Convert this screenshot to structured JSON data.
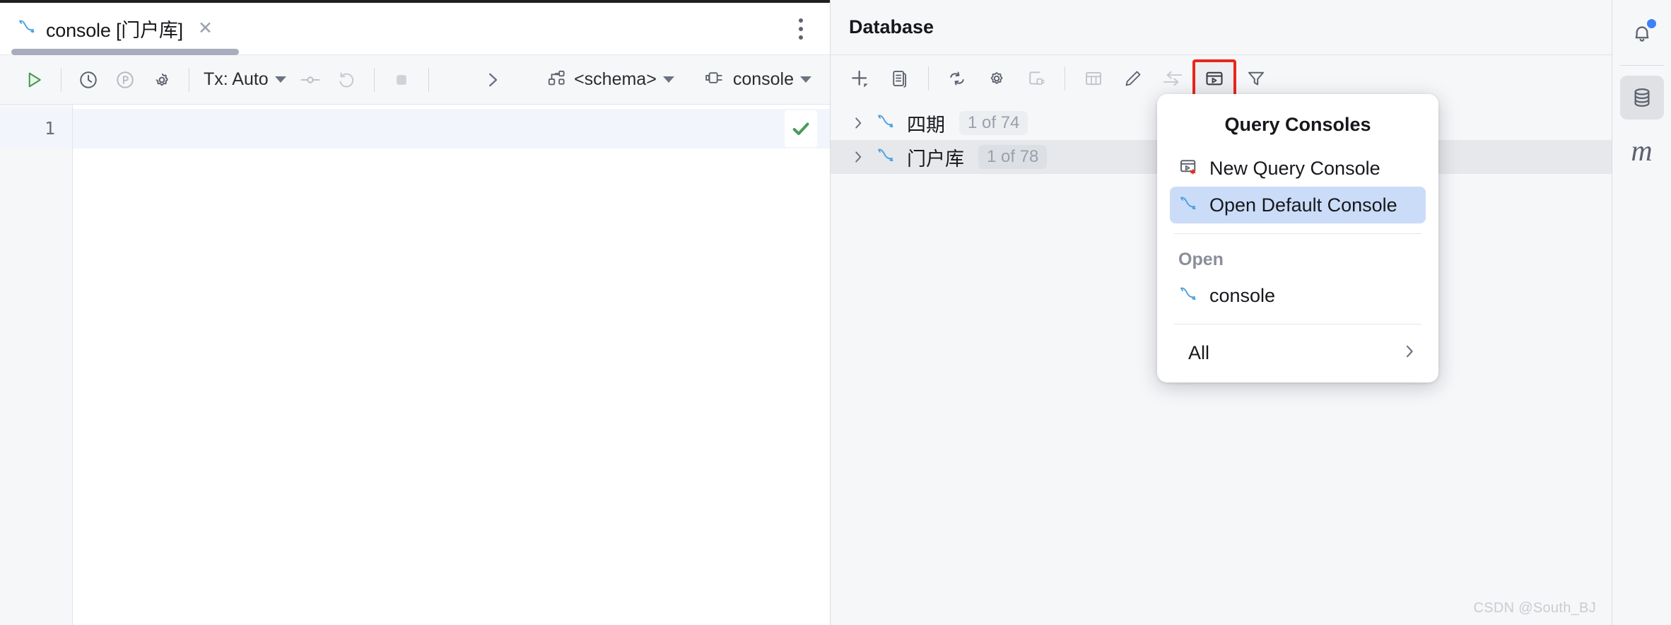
{
  "window": {
    "watermark": "CSDN @South_BJ"
  },
  "editor": {
    "tab": {
      "icon": "mysql-dolphin-icon",
      "label": "console [门户库]",
      "close_label": "✕"
    },
    "kebab_label": "more-options",
    "toolbar": {
      "execute_label": "execute-icon",
      "history_label": "history-icon",
      "profile_label": "profile-icon",
      "settings_label": "gear-icon",
      "tx_label": "Tx: Auto",
      "commit_label": "commit-icon",
      "rollback_label": "rollback-icon",
      "stop_label": "stop-icon",
      "expand_label": "›",
      "schema_label": "<schema>",
      "session_label": "console"
    },
    "gutter": {
      "lines": [
        "1"
      ]
    },
    "code": {
      "line1": ""
    },
    "status": {
      "check_label": "✓"
    }
  },
  "database": {
    "header": {
      "title": "Database"
    },
    "toolbar": [
      {
        "name": "add-icon",
        "title": "New"
      },
      {
        "name": "duplicate-icon",
        "title": "Duplicate"
      },
      {
        "name": "refresh-icon",
        "title": "Refresh"
      },
      {
        "name": "gear-icon",
        "title": "Data Source Properties"
      },
      {
        "name": "disconnect-icon",
        "title": "Disconnect"
      },
      {
        "name": "table-icon",
        "title": "Table"
      },
      {
        "name": "edit-icon",
        "title": "Modify"
      },
      {
        "name": "jump-to-icon",
        "title": "Jump to"
      },
      {
        "name": "query-console-icon",
        "title": "Query Console",
        "highlighted": true
      },
      {
        "name": "filter-icon",
        "title": "Filter"
      }
    ],
    "tree": [
      {
        "label": "四期",
        "badge": "1 of 74",
        "icon": "mysql-dolphin-icon",
        "selected": false
      },
      {
        "label": "门户库",
        "badge": "1 of 78",
        "icon": "mysql-dolphin-icon",
        "selected": true
      }
    ]
  },
  "popup": {
    "title": "Query Consoles",
    "items": [
      {
        "label": "New Query Console",
        "icon": "new-query-console-icon",
        "active": false
      },
      {
        "label": "Open Default Console",
        "icon": "mysql-dolphin-icon",
        "active": true
      }
    ],
    "section_label": "Open",
    "open_items": [
      {
        "label": "console",
        "icon": "mysql-dolphin-icon"
      }
    ],
    "all_label": "All",
    "all_chevron": "›"
  },
  "rail": {
    "items": [
      {
        "name": "notifications-icon",
        "label": "Notifications",
        "badge": true,
        "active": false
      },
      {
        "name": "database-icon",
        "label": "Database",
        "badge": false,
        "active": true
      },
      {
        "name": "maven-icon",
        "label": "m",
        "badge": false,
        "active": false
      }
    ]
  },
  "colors": {
    "accent_blue": "#3b82f6",
    "highlight_red": "#e8271a",
    "menu_selection": "#cbdcf8",
    "success_green": "#4a9a5c",
    "mysql_blue": "#4a9fe0"
  }
}
